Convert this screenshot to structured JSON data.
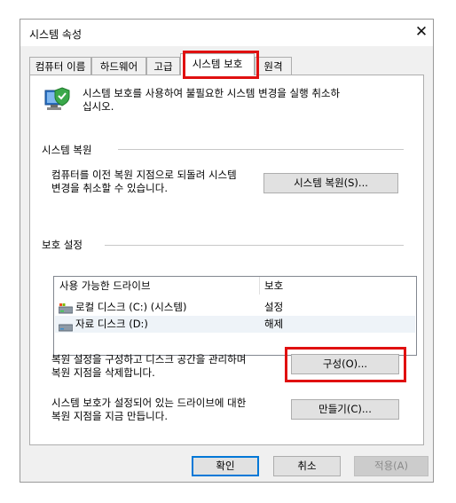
{
  "window": {
    "title": "시스템 속성",
    "close_glyph": "✕"
  },
  "tabs": [
    {
      "label": "컴퓨터 이름"
    },
    {
      "label": "하드웨어"
    },
    {
      "label": "고급"
    },
    {
      "label": "시스템 보호"
    },
    {
      "label": "원격"
    }
  ],
  "intro": {
    "text": "시스템 보호를 사용하여 불필요한 시스템 변경을 실행 취소하\n십시오."
  },
  "restore": {
    "heading": "시스템 복원",
    "description": "컴퓨터를 이전 복원 지점으로 되돌려 시스템\n변경을 취소할 수 있습니다.",
    "button": "시스템 복원(S)..."
  },
  "protection": {
    "heading": "보호 설정",
    "columns": [
      "사용 가능한 드라이브",
      "보호"
    ],
    "drives": [
      {
        "name": "로컬 디스크 (C:) (시스템)",
        "status": "설정",
        "icon": "system-drive-icon"
      },
      {
        "name": "자료 디스크 (D:)",
        "status": "해제",
        "icon": "drive-icon"
      }
    ]
  },
  "configure": {
    "description": "복원 설정을 구성하고 디스크 공간을 관리하며\n복원 지점을 삭제합니다.",
    "button": "구성(O)..."
  },
  "create": {
    "description": "시스템 보호가 설정되어 있는 드라이브에 대한\n복원 지점을 지금 만듭니다.",
    "button": "만들기(C)..."
  },
  "footer": {
    "ok": "확인",
    "cancel": "취소",
    "apply": "적용(A)"
  },
  "colors": {
    "highlight_red": "#e01010",
    "accent_blue": "#0078d7"
  }
}
